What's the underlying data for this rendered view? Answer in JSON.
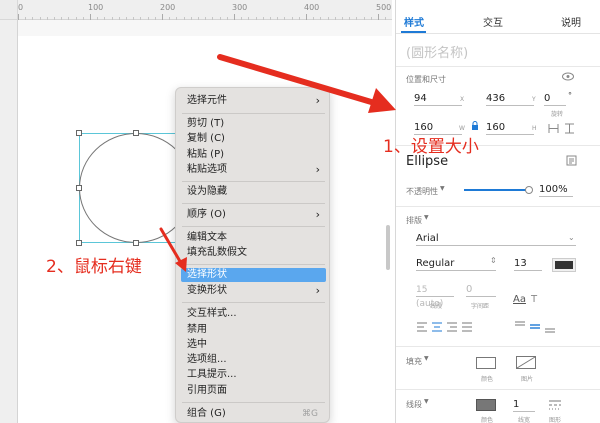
{
  "ruler": {
    "labels": [
      "0",
      "100",
      "200",
      "300",
      "400",
      "500"
    ]
  },
  "context_menu": {
    "items": [
      {
        "label": "选择元件",
        "submenu": true
      },
      {
        "label": "剪切 (T)"
      },
      {
        "label": "复制 (C)"
      },
      {
        "label": "粘贴 (P)"
      },
      {
        "label": "粘贴选项",
        "submenu": true
      },
      {
        "label": "设为隐藏"
      },
      {
        "label": "顺序 (O)",
        "submenu": true
      },
      {
        "label": "编辑文本"
      },
      {
        "label": "填充乱数假文"
      },
      {
        "label": "选择形状",
        "highlighted": true
      },
      {
        "label": "变换形状",
        "submenu": true
      },
      {
        "label": "交互样式..."
      },
      {
        "label": "禁用"
      },
      {
        "label": "选中"
      },
      {
        "label": "选项组..."
      },
      {
        "label": "工具提示..."
      },
      {
        "label": "引用页面"
      },
      {
        "label": "组合 (G)",
        "shortcut": "⌘G"
      }
    ]
  },
  "annotations": {
    "step1": "1、设置大小",
    "step2": "2、鼠标右键",
    "color": "#e52d1f"
  },
  "panel": {
    "tabs": [
      "样式",
      "交互",
      "说明"
    ],
    "active_tab": "样式",
    "shape_name_placeholder": "(圆形名称)",
    "position_size_label": "位置和尺寸",
    "x_value": "94",
    "x_label": "X",
    "y_value": "436",
    "y_label": "Y",
    "rotation_value": "0",
    "rotation_unit": "°",
    "rotation_label": "旋转",
    "w_value": "160",
    "w_label": "W",
    "h_value": "160",
    "h_label": "H",
    "shape_type": "Ellipse",
    "opacity_label": "不透明性",
    "opacity_value": "100%",
    "typography_label": "排版",
    "font_family": "Arial",
    "font_style": "Regular",
    "font_size": "13",
    "line_spacing_value": "15 (auto)",
    "line_spacing_label": "线段",
    "char_spacing_value": "0",
    "char_spacing_label": "字间距",
    "fill_label": "填充",
    "fill_color_label": "颜色",
    "fill_image_label": "图片",
    "border_label": "线段",
    "border_color_label": "颜色",
    "border_width_value": "1",
    "border_width_label": "线宽",
    "border_pattern_label": "图形",
    "accent_color": "#1e7ad6"
  }
}
